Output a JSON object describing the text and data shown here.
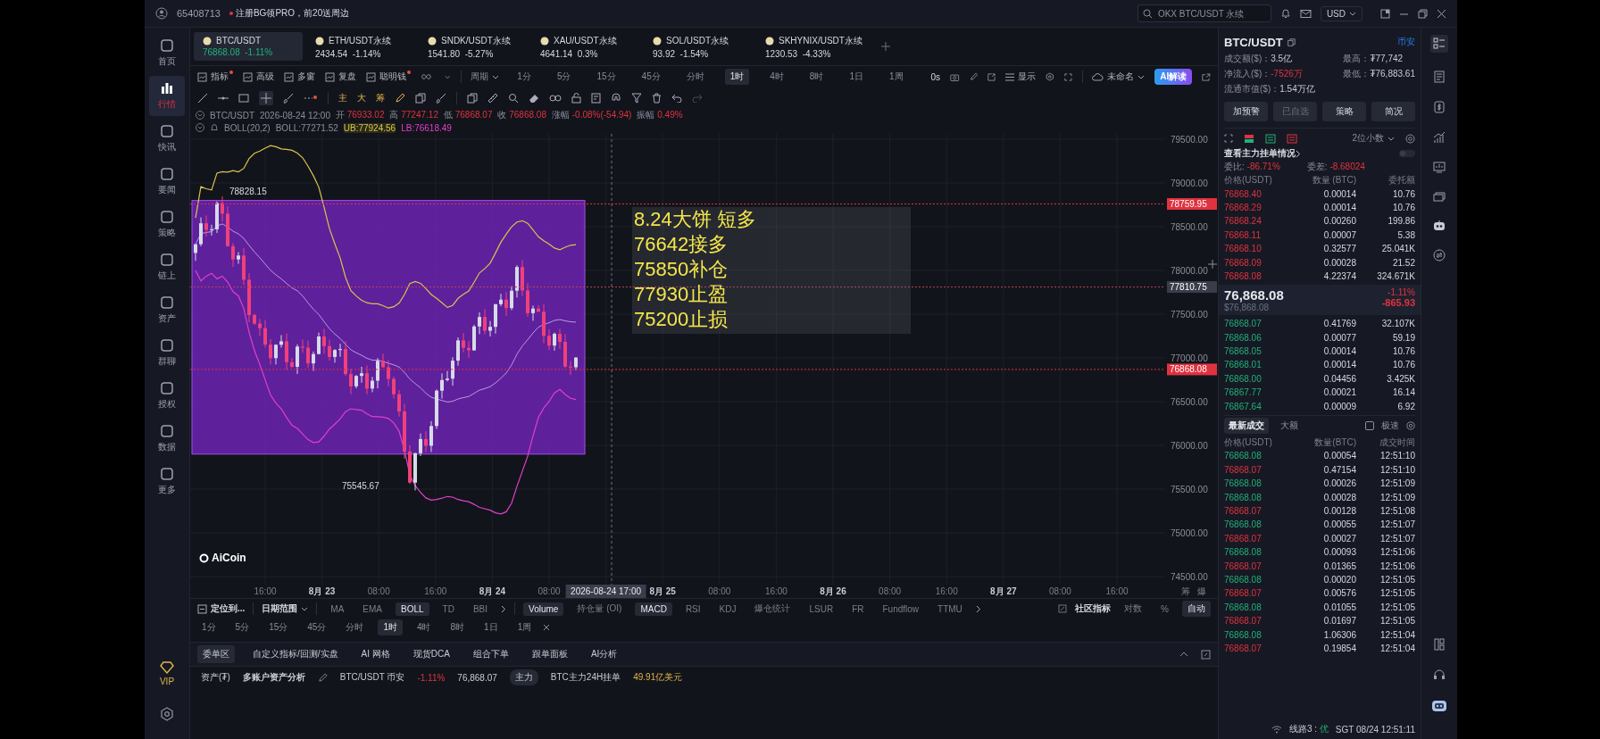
{
  "top_bar": {
    "account": "65408713",
    "notice": "注册BG领PRO，前20送周边",
    "search": {
      "placeholder": "OKX BTC/USDT 永续"
    },
    "currency": "USD"
  },
  "sidebar": {
    "items": [
      {
        "label": "首页",
        "selected": false
      },
      {
        "label": "行情",
        "selected": true
      },
      {
        "label": "快讯",
        "selected": false
      },
      {
        "label": "要闻",
        "selected": false
      },
      {
        "label": "策略",
        "selected": false
      },
      {
        "label": "链上",
        "selected": false
      },
      {
        "label": "资产",
        "selected": false
      },
      {
        "label": "群聊",
        "selected": false
      },
      {
        "label": "授权",
        "selected": false
      },
      {
        "label": "数据",
        "selected": false
      },
      {
        "label": "更多",
        "selected": false
      }
    ],
    "vip": "VIP"
  },
  "tabs": [
    {
      "symbol": "BTC/USDT",
      "price": "76868.08",
      "change": "-1.11%",
      "selected": true
    },
    {
      "symbol": "ETH/USDT永续",
      "price": "2434.54",
      "change": "-1.14%",
      "selected": false
    },
    {
      "symbol": "SNDK/USDT永续",
      "price": "1541.80",
      "change": "-5.27%",
      "selected": false
    },
    {
      "symbol": "XAU/USDT永续",
      "price": "4641.14",
      "change": "0.3%",
      "selected": false
    },
    {
      "symbol": "SOL/USDT永续",
      "price": "93.92",
      "change": "-1.54%",
      "selected": false
    },
    {
      "symbol": "SKHYNIX/USDT永续",
      "price": "1230.53",
      "change": "-4.33%",
      "selected": false
    }
  ],
  "toolbar": {
    "items": [
      {
        "label": "指标",
        "dot": true
      },
      {
        "label": "高级",
        "dot": false
      },
      {
        "label": "多窗",
        "dot": false
      },
      {
        "label": "复盘",
        "dot": false
      },
      {
        "label": "聪明钱",
        "dot": true
      }
    ],
    "period_menu": "周期",
    "periods": [
      {
        "label": "1分",
        "selected": false
      },
      {
        "label": "5分",
        "selected": false
      },
      {
        "label": "15分",
        "selected": false
      },
      {
        "label": "45分",
        "selected": false
      },
      {
        "label": "分时",
        "selected": false
      },
      {
        "label": "1时",
        "selected": true
      },
      {
        "label": "4时",
        "selected": false
      },
      {
        "label": "8时",
        "selected": false
      },
      {
        "label": "1日",
        "selected": false
      },
      {
        "label": "1周",
        "selected": false
      }
    ],
    "countdown": "0s",
    "display": "显示",
    "layout_name": "未命名",
    "ai_button": "AI解读"
  },
  "drawing_tools": {
    "texts": [
      "主",
      "大",
      "筹"
    ]
  },
  "ohlc": {
    "symbol": "BTC/USDT",
    "time": "2026-08-24 12:00",
    "fields": [
      {
        "label": "开",
        "value": "76933.02"
      },
      {
        "label": "高",
        "value": "77247.12"
      },
      {
        "label": "低",
        "value": "76868.07"
      },
      {
        "label": "收",
        "value": "76868.08"
      },
      {
        "label": "涨幅",
        "value": "-0.08%(-54.94)"
      },
      {
        "label": "振幅",
        "value": "0.49%"
      }
    ]
  },
  "boll": {
    "name": "BOLL(20,2)",
    "mid": "BOLL:77271.52",
    "upper": "UB:77924.56",
    "lower": "LB:76618.49"
  },
  "chart": {
    "yticks": [
      "79500.00",
      "79000.00",
      "78500.00",
      "78000.00",
      "77500.00",
      "77000.00",
      "76500.00",
      "76000.00",
      "75500.00",
      "75000.00",
      "74500.00"
    ],
    "price_tags": [
      {
        "value": "78759.95",
        "kind": "alert"
      },
      {
        "value": "77810.75",
        "kind": "cursor"
      },
      {
        "value": "76868.08",
        "kind": "last"
      }
    ],
    "high_label": "78828.15",
    "low_label": "75545.67",
    "note": [
      "8.24大饼 短多",
      "76642接多",
      "75850补仓",
      "77930止盈",
      "75200止损"
    ],
    "logo": "AiCoin",
    "xticks": [
      {
        "label": "16:00",
        "kind": "time"
      },
      {
        "label": "8月 23",
        "kind": "day"
      },
      {
        "label": "08:00",
        "kind": "time"
      },
      {
        "label": "16:00",
        "kind": "time"
      },
      {
        "label": "8月 24",
        "kind": "day"
      },
      {
        "label": "08:00",
        "kind": "time"
      },
      {
        "label": "2026-08-24 17:00",
        "kind": "cursor"
      },
      {
        "label": "8月 25",
        "kind": "day"
      },
      {
        "label": "08:00",
        "kind": "time"
      },
      {
        "label": "16:00",
        "kind": "time"
      },
      {
        "label": "8月 26",
        "kind": "day"
      },
      {
        "label": "08:00",
        "kind": "time"
      },
      {
        "label": "16:00",
        "kind": "time"
      },
      {
        "label": "8月 27",
        "kind": "day"
      },
      {
        "label": "08:00",
        "kind": "time"
      },
      {
        "label": "16:00",
        "kind": "time"
      }
    ],
    "corner": [
      "筹",
      "爆"
    ]
  },
  "indicator_bar": {
    "locate": "定位到...",
    "date_range": "日期范围",
    "main": [
      {
        "label": "MA",
        "selected": false
      },
      {
        "label": "EMA",
        "selected": false
      },
      {
        "label": "BOLL",
        "selected": true
      },
      {
        "label": "TD",
        "selected": false
      },
      {
        "label": "BBI",
        "selected": false
      }
    ],
    "sub": [
      {
        "label": "Volume",
        "selected": true
      },
      {
        "label": "持仓量 (OI)",
        "selected": false
      },
      {
        "label": "MACD",
        "selected": true
      },
      {
        "label": "RSI",
        "selected": false
      },
      {
        "label": "KDJ",
        "selected": false
      },
      {
        "label": "爆仓统计",
        "selected": false
      },
      {
        "label": "LSUR",
        "selected": false
      },
      {
        "label": "FR",
        "selected": false
      },
      {
        "label": "Fundflow",
        "selected": false
      },
      {
        "label": "TTMU",
        "selected": false
      }
    ],
    "community": "社区指标",
    "options": [
      {
        "label": "对数",
        "selected": false
      },
      {
        "label": "%",
        "selected": false
      },
      {
        "label": "自动",
        "selected": true
      }
    ]
  },
  "period_bar": [
    {
      "label": "1分",
      "selected": false
    },
    {
      "label": "5分",
      "selected": false
    },
    {
      "label": "15分",
      "selected": false
    },
    {
      "label": "45分",
      "selected": false
    },
    {
      "label": "分时",
      "selected": false
    },
    {
      "label": "1时",
      "selected": true
    },
    {
      "label": "4时",
      "selected": false
    },
    {
      "label": "8时",
      "selected": false
    },
    {
      "label": "1日",
      "selected": false
    },
    {
      "label": "1周",
      "selected": false
    }
  ],
  "bottom_tabs": [
    {
      "label": "委单区",
      "selected": true
    },
    {
      "label": "自定义指标/回测/实盘",
      "selected": false
    },
    {
      "label": "AI 网格",
      "selected": false
    },
    {
      "label": "现货DCA",
      "selected": false
    },
    {
      "label": "组合下单",
      "selected": false
    },
    {
      "label": "跟单面板",
      "selected": false
    },
    {
      "label": "AI分析",
      "selected": false
    }
  ],
  "status_bar": {
    "assets": "资产(₮)",
    "analysis": "多账户资产分析",
    "pair": "BTC/USDT 币安",
    "change": "-1.11%",
    "price": "76,868.07",
    "main_tag": "主力",
    "main_text": "BTC主力24H挂单",
    "main_value": "49.91亿美元",
    "line": "线路3 : ",
    "quality": "优",
    "time": "SGT 08/24 12:51:11"
  },
  "panel": {
    "symbol": "BTC/USDT",
    "exchange": "币安",
    "stats": [
      {
        "label": "成交额($)：",
        "value": "3.5亿",
        "negative": false
      },
      {
        "label": "最高：",
        "value": "₮77,742",
        "negative": false
      },
      {
        "label": "净流入($)：",
        "value": "-7526万",
        "negative": true
      },
      {
        "label": "最低：",
        "value": "₮76,883.61",
        "negative": false
      },
      {
        "label": "流通市值($)：",
        "value": "1.54万亿",
        "negative": false
      }
    ],
    "buttons": [
      {
        "label": "加预警",
        "disabled": false
      },
      {
        "label": "已自选",
        "disabled": true
      },
      {
        "label": "策略",
        "disabled": false
      },
      {
        "label": "简况",
        "disabled": false
      }
    ],
    "decimals": "2位小数",
    "main_orders": "查看主力挂单情况",
    "main_orders_toggle": {
      "on": false
    },
    "ratio": {
      "label": "委比:",
      "value": "-86.71%"
    },
    "diff": {
      "label": "委差:",
      "value": "-8.68024"
    },
    "book_headers": [
      "价格(USDT)",
      "数量 (BTC)",
      "委托额"
    ],
    "asks": [
      {
        "price": "76868.40",
        "qty": "0.00014",
        "amount": "10.76"
      },
      {
        "price": "76868.29",
        "qty": "0.00014",
        "amount": "10.76"
      },
      {
        "price": "76868.24",
        "qty": "0.00260",
        "amount": "199.86"
      },
      {
        "price": "76868.11",
        "qty": "0.00007",
        "amount": "5.38"
      },
      {
        "price": "76868.10",
        "qty": "0.32577",
        "amount": "25.041K"
      },
      {
        "price": "76868.09",
        "qty": "0.00028",
        "amount": "21.52"
      },
      {
        "price": "76868.08",
        "qty": "4.22374",
        "amount": "324.671K"
      }
    ],
    "last": {
      "price": "76,868.08",
      "usd": "$76,868.08",
      "change": "-1.11%",
      "diff": "-865.93"
    },
    "bids": [
      {
        "price": "76868.07",
        "qty": "0.41769",
        "amount": "32.107K"
      },
      {
        "price": "76868.06",
        "qty": "0.00077",
        "amount": "59.19"
      },
      {
        "price": "76868.05",
        "qty": "0.00014",
        "amount": "10.76"
      },
      {
        "price": "76868.01",
        "qty": "0.00014",
        "amount": "10.76"
      },
      {
        "price": "76868.00",
        "qty": "0.04456",
        "amount": "3.425K"
      },
      {
        "price": "76867.77",
        "qty": "0.00021",
        "amount": "16.14"
      },
      {
        "price": "76867.64",
        "qty": "0.00009",
        "amount": "6.92"
      }
    ],
    "trade_tabs": [
      {
        "label": "最新成交",
        "selected": true
      },
      {
        "label": "大额",
        "selected": false
      }
    ],
    "fast": {
      "label": "极速",
      "checked": false
    },
    "trade_headers": [
      "价格(USDT)",
      "数量(BTC)",
      "成交时间"
    ],
    "trades": [
      {
        "price": "76868.08",
        "qty": "0.00054",
        "time": "12:51:10",
        "color": "#21b07a"
      },
      {
        "price": "76868.07",
        "qty": "0.47154",
        "time": "12:51:10",
        "color": "#e0323f"
      },
      {
        "price": "76868.08",
        "qty": "0.00026",
        "time": "12:51:09",
        "color": "#21b07a"
      },
      {
        "price": "76868.08",
        "qty": "0.00028",
        "time": "12:51:09",
        "color": "#21b07a"
      },
      {
        "price": "76868.07",
        "qty": "0.00128",
        "time": "12:51:08",
        "color": "#e0323f"
      },
      {
        "price": "76868.08",
        "qty": "0.00055",
        "time": "12:51:07",
        "color": "#21b07a"
      },
      {
        "price": "76868.07",
        "qty": "0.00027",
        "time": "12:51:07",
        "color": "#e0323f"
      },
      {
        "price": "76868.08",
        "qty": "0.00093",
        "time": "12:51:06",
        "color": "#21b07a"
      },
      {
        "price": "76868.07",
        "qty": "0.01365",
        "time": "12:51:06",
        "color": "#e0323f"
      },
      {
        "price": "76868.08",
        "qty": "0.00020",
        "time": "12:51:05",
        "color": "#21b07a"
      },
      {
        "price": "76868.07",
        "qty": "0.00576",
        "time": "12:51:05",
        "color": "#e0323f"
      },
      {
        "price": "76868.08",
        "qty": "0.01055",
        "time": "12:51:05",
        "color": "#21b07a"
      },
      {
        "price": "76868.07",
        "qty": "0.01697",
        "time": "12:51:05",
        "color": "#e0323f"
      },
      {
        "price": "76868.08",
        "qty": "1.06306",
        "time": "12:51:04",
        "color": "#21b07a"
      },
      {
        "price": "76868.07",
        "qty": "0.19854",
        "time": "12:51:04",
        "color": "#e0323f"
      }
    ]
  }
}
